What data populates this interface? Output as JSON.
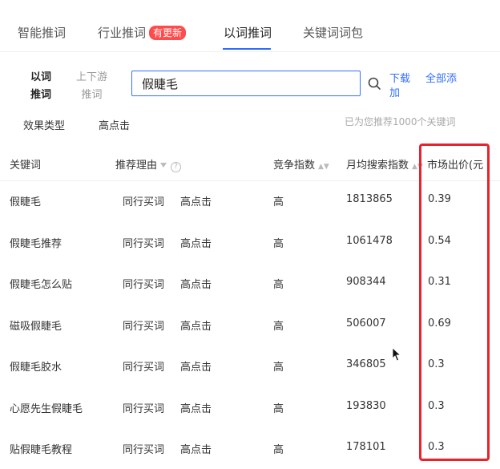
{
  "tabs": [
    {
      "label": "智能推词"
    },
    {
      "label": "行业推词",
      "badge": "有更新"
    },
    {
      "label": "以词推词"
    },
    {
      "label": "关键词词包"
    }
  ],
  "search": {
    "mode_active_line1": "以词",
    "mode_active_line2": "推词",
    "mode_inactive_line1": "上下游",
    "mode_inactive_line2": "推词",
    "value": "假睫毛",
    "download_line1": "下载",
    "download_line2": "加",
    "add_all": "全部添"
  },
  "filters": {
    "label": "效果类型",
    "value": "高点击",
    "hint": "已为您推荐1000个关键词"
  },
  "table": {
    "headers": {
      "keyword": "关键词",
      "reason": "推荐理由",
      "competition": "竞争指数",
      "search": "月均搜索指数",
      "price": "市场出价(元"
    },
    "rows": [
      {
        "keyword": "假睫毛",
        "reason1": "同行买词",
        "reason2": "高点击",
        "competition": "高",
        "search": "1813865",
        "price": "0.39"
      },
      {
        "keyword": "假睫毛推荐",
        "reason1": "同行买词",
        "reason2": "高点击",
        "competition": "高",
        "search": "1061478",
        "price": "0.54"
      },
      {
        "keyword": "假睫毛怎么贴",
        "reason1": "同行买词",
        "reason2": "高点击",
        "competition": "高",
        "search": "908344",
        "price": "0.31"
      },
      {
        "keyword": "磁吸假睫毛",
        "reason1": "同行买词",
        "reason2": "高点击",
        "competition": "高",
        "search": "506007",
        "price": "0.69"
      },
      {
        "keyword": "假睫毛胶水",
        "reason1": "同行买词",
        "reason2": "高点击",
        "competition": "高",
        "search": "346805",
        "price": "0.3"
      },
      {
        "keyword": "心愿先生假睫毛",
        "reason1": "同行买词",
        "reason2": "高点击",
        "competition": "高",
        "search": "193830",
        "price": "0.3"
      },
      {
        "keyword": "贴假睫毛教程",
        "reason1": "同行买词",
        "reason2": "高点击",
        "competition": "高",
        "search": "178101",
        "price": "0.3"
      }
    ]
  },
  "colors": {
    "accent": "#3370ff",
    "badge": "#ff4b4b",
    "highlight": "#e8232b"
  }
}
